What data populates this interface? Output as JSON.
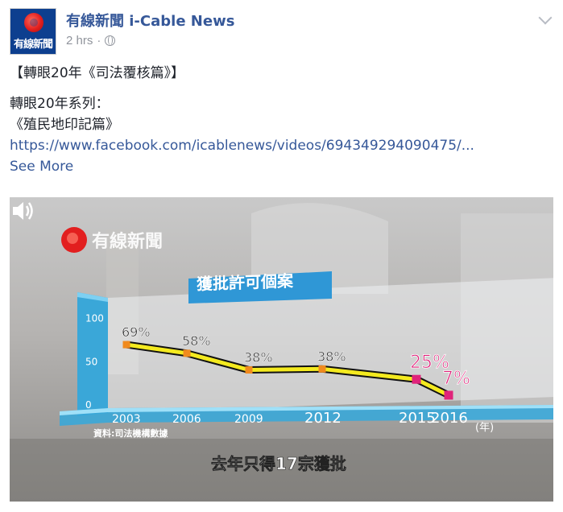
{
  "post": {
    "page_name": "有線新聞 i-Cable News",
    "avatar_text": "有線新聞",
    "time": "2 hrs",
    "separator": "·",
    "title_line": "【轉眼20年《司法覆核篇》】",
    "series_line": "轉眼20年系列：",
    "series_item": "《殖民地印記篇》",
    "link": "https://www.facebook.com/icablenews/videos/694349294090475/...",
    "see_more": "See More"
  },
  "video": {
    "logo_text": "有線新聞",
    "caption": "去年只得17宗獲批",
    "source_note": "資料:司法機構數據",
    "chart_data": {
      "type": "line",
      "title": "獲批許可個案",
      "x": [
        "2003",
        "2006",
        "2009",
        "2012",
        "2015",
        "2016"
      ],
      "values": [
        69,
        58,
        38,
        38,
        25,
        7
      ],
      "value_labels": [
        "69%",
        "58%",
        "38%",
        "38%",
        "25%",
        "7%"
      ],
      "x_unit": "(年)",
      "y_ticks": [
        "100",
        "50",
        "0"
      ],
      "ylim": [
        0,
        100
      ],
      "grid": false,
      "colors": {
        "line": "#f4ea1f",
        "marker_old": "#f08a1e",
        "marker_new": "#e0237a",
        "axis": "#3aa7d8"
      }
    }
  }
}
